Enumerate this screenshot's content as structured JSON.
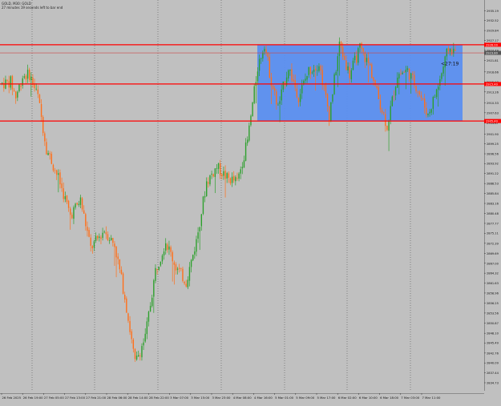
{
  "header": {
    "symbol_line": "GOLD, M30: GOLD",
    "timer_line": "27 minutes 19 seconds left to bar end"
  },
  "countdown_label": "<27:19",
  "colors": {
    "background": "#c0c0c0",
    "bull": "#2ca02c",
    "bear": "#ff6f1a",
    "level_line": "#ff0000",
    "zone_fill": "#5b8ff0",
    "grid": "#555555"
  },
  "price_axis": {
    "ticks": [
      "2935.19",
      "2932.52",
      "2929.84",
      "2927.17",
      "2924.49",
      "2921.81",
      "2918.66",
      "2915.93",
      "2913.26",
      "2910.33",
      "2907.63",
      "2904.87",
      "2901.90",
      "2899.25",
      "2896.56",
      "2893.92",
      "2891.22",
      "2888.53",
      "2885.84",
      "2883.16",
      "2880.48",
      "2877.77",
      "2875.11",
      "2872.39",
      "2869.69",
      "2867.00",
      "2864.32",
      "2861.63",
      "2858.96",
      "2856.25",
      "2853.56",
      "2850.87",
      "2848.10",
      "2845.49",
      "2842.76",
      "2840.09",
      "2837.44",
      "2834.73"
    ],
    "level_tags": [
      "2926.00",
      "2923.80",
      "2915.40",
      "2905.40"
    ]
  },
  "time_axis": {
    "labels": [
      "26 Feb 2025",
      "26 Feb 19:00",
      "27 Feb 05:00",
      "27 Feb 13:00",
      "27 Feb 21:00",
      "28 Feb 06:00",
      "28 Feb 14:00",
      "28 Feb 22:00",
      "3 Mar 07:00",
      "3 Mar 15:00",
      "3 Mar 23:00",
      "4 Mar 08:00",
      "4 Mar 16:00",
      "5 Mar 01:00",
      "5 Mar 09:00",
      "5 Mar 17:00",
      "6 Mar 02:00",
      "6 Mar 10:00",
      "6 Mar 18:00",
      "7 Mar 03:00",
      "7 Mar 11:00"
    ]
  },
  "chart_data": {
    "type": "candlestick",
    "symbol": "GOLD",
    "timeframe": "M30",
    "y_range": [
      2833,
      2937
    ],
    "horizontal_levels": [
      2926.0,
      2923.8,
      2915.4,
      2905.4
    ],
    "zone": {
      "price_top": 2926.0,
      "price_bottom": 2905.4
    },
    "close_path": [
      {
        "bar": 0,
        "price": 2915.5
      },
      {
        "bar": 5,
        "price": 2916.0
      },
      {
        "bar": 8,
        "price": 2912.0
      },
      {
        "bar": 12,
        "price": 2917.5
      },
      {
        "bar": 16,
        "price": 2918.0
      },
      {
        "bar": 21,
        "price": 2912.0
      },
      {
        "bar": 26,
        "price": 2898.0
      },
      {
        "bar": 33,
        "price": 2890.0
      },
      {
        "bar": 40,
        "price": 2880.0
      },
      {
        "bar": 46,
        "price": 2884.0
      },
      {
        "bar": 52,
        "price": 2871.0
      },
      {
        "bar": 60,
        "price": 2876.0
      },
      {
        "bar": 66,
        "price": 2872.0
      },
      {
        "bar": 72,
        "price": 2858.0
      },
      {
        "bar": 78,
        "price": 2840.0
      },
      {
        "bar": 84,
        "price": 2847.0
      },
      {
        "bar": 90,
        "price": 2865.0
      },
      {
        "bar": 96,
        "price": 2873.0
      },
      {
        "bar": 102,
        "price": 2866.0
      },
      {
        "bar": 108,
        "price": 2862.0
      },
      {
        "bar": 114,
        "price": 2873.0
      },
      {
        "bar": 120,
        "price": 2889.0
      },
      {
        "bar": 126,
        "price": 2893.0
      },
      {
        "bar": 132,
        "price": 2890.0
      },
      {
        "bar": 138,
        "price": 2889.0
      },
      {
        "bar": 144,
        "price": 2900.0
      },
      {
        "bar": 150,
        "price": 2920.0
      },
      {
        "bar": 154,
        "price": 2926.5
      },
      {
        "bar": 158,
        "price": 2916.0
      },
      {
        "bar": 162,
        "price": 2909.0
      },
      {
        "bar": 168,
        "price": 2920.0
      },
      {
        "bar": 174,
        "price": 2912.0
      },
      {
        "bar": 180,
        "price": 2919.0
      },
      {
        "bar": 186,
        "price": 2921.0
      },
      {
        "bar": 192,
        "price": 2907.0
      },
      {
        "bar": 198,
        "price": 2926.0
      },
      {
        "bar": 204,
        "price": 2918.0
      },
      {
        "bar": 210,
        "price": 2925.0
      },
      {
        "bar": 216,
        "price": 2920.0
      },
      {
        "bar": 220,
        "price": 2913.0
      },
      {
        "bar": 226,
        "price": 2904.0
      },
      {
        "bar": 232,
        "price": 2918.0
      },
      {
        "bar": 238,
        "price": 2919.0
      },
      {
        "bar": 244,
        "price": 2914.0
      },
      {
        "bar": 250,
        "price": 2907.0
      },
      {
        "bar": 256,
        "price": 2915.0
      },
      {
        "bar": 262,
        "price": 2925.0
      },
      {
        "bar": 266,
        "price": 2924.0
      }
    ]
  }
}
